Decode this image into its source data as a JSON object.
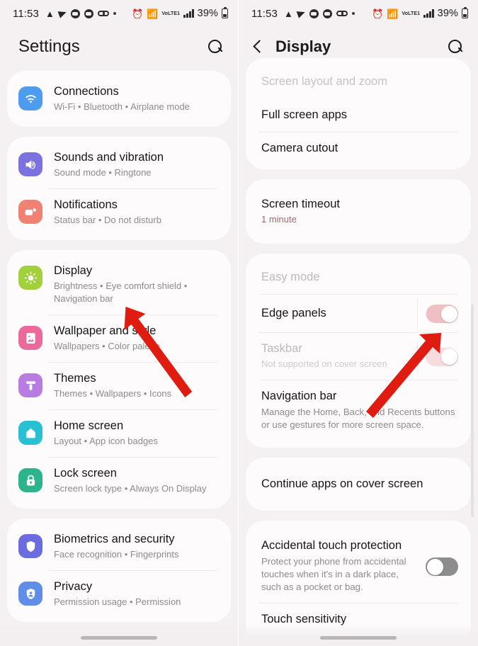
{
  "status_bar": {
    "time": "11:53",
    "left_icons": [
      "notification-icon",
      "telegram-icon",
      "app-badge-icon",
      "app-badge-icon-2",
      "glasses-icon",
      "dot-icon"
    ],
    "alarm_icon": "alarm-icon",
    "wifi_icon": "wifi-icon",
    "volte_label": "VoLTE1",
    "signal_icon": "signal-bars-icon",
    "battery_percent": "39%",
    "battery_icon": "battery-icon"
  },
  "left_screen": {
    "title": "Settings",
    "search_icon": "search-icon",
    "groups": [
      {
        "rows": [
          {
            "title": "Connections",
            "subtitle": "Wi-Fi  •  Bluetooth  •  Airplane mode",
            "icon": "wifi-icon",
            "color": "#4e9cf0"
          }
        ]
      },
      {
        "rows": [
          {
            "title": "Sounds and vibration",
            "subtitle": "Sound mode  •  Ringtone",
            "icon": "speaker-icon",
            "color": "#7b72e0"
          },
          {
            "title": "Notifications",
            "subtitle": "Status bar  •  Do not disturb",
            "icon": "notification-bell-icon",
            "color": "#f08273"
          }
        ]
      },
      {
        "rows": [
          {
            "title": "Display",
            "subtitle": "Brightness  •  Eye comfort shield  •  Navigation bar",
            "icon": "brightness-icon",
            "color": "#a2d03c"
          },
          {
            "title": "Wallpaper and style",
            "subtitle": "Wallpapers  •  Color palette",
            "icon": "image-icon",
            "color": "#ec6a9b"
          },
          {
            "title": "Themes",
            "subtitle": "Themes  •  Wallpapers  •  Icons",
            "icon": "paint-brush-icon",
            "color": "#b濃"
          },
          {
            "title": "Home screen",
            "subtitle": "Layout  •  App icon badges",
            "icon": "home-icon",
            "color": "#2bbfd4"
          },
          {
            "title": "Lock screen",
            "subtitle": "Screen lock type  •  Always On Display",
            "icon": "lock-icon",
            "color": "#2cb58d"
          }
        ]
      },
      {
        "rows": [
          {
            "title": "Biometrics and security",
            "subtitle": "Face recognition  •  Fingerprints",
            "icon": "shield-icon",
            "color": "#6a6ce0"
          },
          {
            "title": "Privacy",
            "subtitle": "Permission usage  •  Permission",
            "icon": "privacy-person-icon",
            "color": "#5f8de8"
          }
        ]
      }
    ]
  },
  "right_screen": {
    "title": "Display",
    "back_icon": "back-chevron-icon",
    "search_icon": "search-icon",
    "partial_top_row": "Screen layout and zoom",
    "groups": [
      {
        "rows": [
          {
            "title": "Full screen apps"
          },
          {
            "title": "Camera cutout"
          }
        ]
      },
      {
        "rows": [
          {
            "title": "Screen timeout",
            "subtitle": "1 minute",
            "subtitle_accent": true
          }
        ]
      },
      {
        "rows": [
          {
            "title": "Easy mode",
            "dim": true
          },
          {
            "title": "Edge panels",
            "toggle": "on"
          },
          {
            "title": "Taskbar",
            "subtitle": "Not supported on cover screen",
            "dim": true,
            "toggle": "on-faded"
          },
          {
            "title": "Navigation bar",
            "description": "Manage the Home, Back, and Recents buttons or use gestures for more screen space."
          }
        ]
      },
      {
        "rows": [
          {
            "title": "Continue apps on cover screen"
          }
        ]
      },
      {
        "rows": [
          {
            "title": "Accidental touch protection",
            "description": "Protect your phone from accidental touches when it's in a dark place, such as a pocket or bag.",
            "toggle": "off"
          },
          {
            "title": "Touch sensitivity"
          }
        ]
      }
    ]
  },
  "annotations": {
    "left_arrow": "red-arrow-pointing-to-display",
    "right_arrow": "red-arrow-pointing-to-edge-panels-toggle",
    "arrow_color": "#e01b10"
  }
}
